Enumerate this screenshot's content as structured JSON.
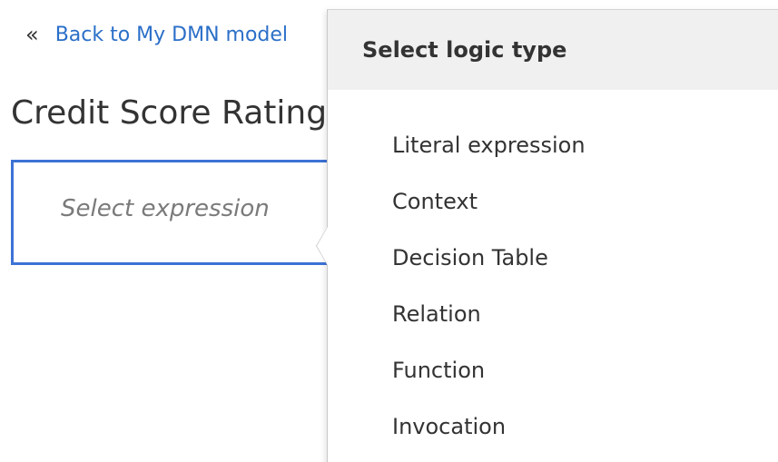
{
  "nav": {
    "back_icon": "«",
    "back_label": "Back to My DMN model"
  },
  "page": {
    "title": "Credit Score Rating"
  },
  "expression": {
    "placeholder": "Select expression"
  },
  "popover": {
    "header": "Select logic type",
    "items": [
      {
        "label": "Literal expression"
      },
      {
        "label": "Context"
      },
      {
        "label": "Decision Table"
      },
      {
        "label": "Relation"
      },
      {
        "label": "Function"
      },
      {
        "label": "Invocation"
      }
    ]
  },
  "colors": {
    "link": "#2b6fc8",
    "selection_border": "#3d72d6",
    "popover_header_bg": "#f0f0f0"
  }
}
